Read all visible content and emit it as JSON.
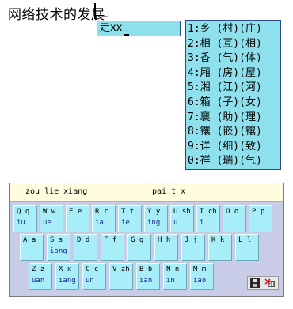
{
  "document": {
    "text": "网络技术的发展",
    "paragraph_mark": "↵"
  },
  "composition": {
    "text": "走xx"
  },
  "candidates": [
    "1:乡 (村)(庄)",
    "2:相 (互)(相)",
    "3:香 (气)(体)",
    "4:厢 (房)(屋)",
    "5:湘 (江)(河)",
    "6:箱 (子)(女)",
    "7:襄 (助)(理)",
    "8:镶 (嵌)(镶)",
    "9:详 (细)(致)",
    "0:祥 (瑞)(气)"
  ],
  "keyboard": {
    "pinyin_hint": "zou lie xiang",
    "spelling_hint": "pai t x",
    "keys": [
      [
        {
          "key": "Q q",
          "final": "iu"
        },
        {
          "key": "W w",
          "final": "ue"
        },
        {
          "key": "E e",
          "final": ""
        },
        {
          "key": "R r",
          "final": "ia"
        },
        {
          "key": "T t",
          "final": "ie"
        },
        {
          "key": "Y y",
          "final": "ing"
        },
        {
          "key": "U sh",
          "final": "u"
        },
        {
          "key": "I ch",
          "final": "i"
        },
        {
          "key": "O o",
          "final": ""
        },
        {
          "key": "P p",
          "final": ""
        }
      ],
      [
        {
          "key": "A a",
          "final": ""
        },
        {
          "key": "S s",
          "final": "iong"
        },
        {
          "key": "D d",
          "final": ""
        },
        {
          "key": "F f",
          "final": ""
        },
        {
          "key": "G g",
          "final": ""
        },
        {
          "key": "H h",
          "final": ""
        },
        {
          "key": "J j",
          "final": ""
        },
        {
          "key": "K k",
          "final": ""
        },
        {
          "key": "L l",
          "final": ""
        }
      ],
      [
        {
          "key": "Z z",
          "final": "uan"
        },
        {
          "key": "X x",
          "final": "iang"
        },
        {
          "key": "C c",
          "final": "un"
        },
        {
          "key": "V zh",
          "final": ""
        },
        {
          "key": "B b",
          "final": "ian"
        },
        {
          "key": "N n",
          "final": "in"
        },
        {
          "key": "M m",
          "final": "iao"
        }
      ]
    ]
  }
}
